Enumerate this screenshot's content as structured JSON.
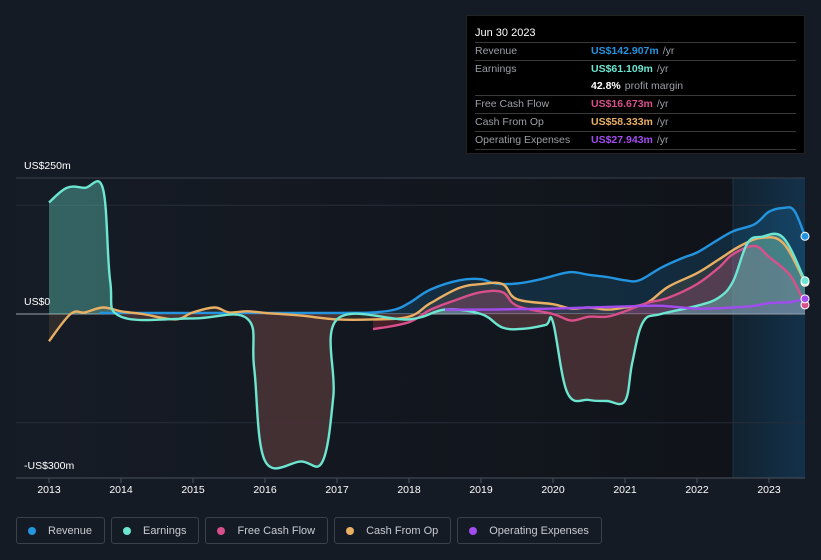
{
  "tooltip": {
    "date": "Jun 30 2023",
    "rows": [
      {
        "label": "Revenue",
        "value": "US$142.907m",
        "unit": "/yr",
        "color": "#2394df"
      },
      {
        "label": "Earnings",
        "value": "US$61.109m",
        "unit": "/yr",
        "color": "#6ce6d1"
      },
      {
        "label": "",
        "value": "42.8%",
        "unit": "profit margin",
        "color": "#ffffff"
      },
      {
        "label": "Free Cash Flow",
        "value": "US$16.673m",
        "unit": "/yr",
        "color": "#d94f8c"
      },
      {
        "label": "Cash From Op",
        "value": "US$58.333m",
        "unit": "/yr",
        "color": "#e9b064"
      },
      {
        "label": "Operating Expenses",
        "value": "US$27.943m",
        "unit": "/yr",
        "color": "#a24cf0"
      }
    ]
  },
  "legend": [
    {
      "label": "Revenue",
      "color": "#2394df"
    },
    {
      "label": "Earnings",
      "color": "#6ce6d1"
    },
    {
      "label": "Free Cash Flow",
      "color": "#d94f8c"
    },
    {
      "label": "Cash From Op",
      "color": "#e9b064"
    },
    {
      "label": "Operating Expenses",
      "color": "#a24cf0"
    }
  ],
  "chart_data": {
    "type": "line",
    "title": "",
    "xlabel": "",
    "ylabel": "",
    "y_tick_labels": [
      "US$250m",
      "US$0",
      "-US$300m"
    ],
    "x_tick_labels": [
      "2013",
      "2014",
      "2015",
      "2016",
      "2017",
      "2018",
      "2019",
      "2020",
      "2021",
      "2022",
      "2023"
    ],
    "xlim": [
      2012.55,
      2023.5
    ],
    "ylim": [
      -340,
      250
    ],
    "grid": true,
    "legend_position": "bottom",
    "highlight_region": [
      2022.5,
      2023.5
    ],
    "series": [
      {
        "name": "Revenue",
        "color": "#2394df",
        "x": [
          2013.7,
          2014.0,
          2015.0,
          2016.0,
          2017.0,
          2017.5,
          2017.8,
          2018.0,
          2018.3,
          2018.7,
          2019.0,
          2019.2,
          2019.5,
          2019.8,
          2020.0,
          2020.25,
          2020.5,
          2020.75,
          2021.0,
          2021.2,
          2021.5,
          2021.8,
          2022.0,
          2022.25,
          2022.5,
          2022.8,
          2023.0,
          2023.2,
          2023.35,
          2023.5
        ],
        "y": [
          2,
          2,
          2,
          2,
          2,
          3,
          8,
          20,
          45,
          62,
          64,
          56,
          56,
          63,
          70,
          77,
          72,
          68,
          62,
          62,
          85,
          103,
          113,
          133,
          152,
          165,
          188,
          195,
          190,
          142.9
        ]
      },
      {
        "name": "Earnings",
        "color": "#6ce6d1",
        "x": [
          2013.0,
          2013.25,
          2013.5,
          2013.75,
          2013.85,
          2014.0,
          2015.0,
          2015.75,
          2015.85,
          2016.0,
          2016.5,
          2016.8,
          2016.95,
          2017.0,
          2018.0,
          2018.5,
          2019.0,
          2019.3,
          2019.6,
          2019.9,
          2020.0,
          2020.2,
          2020.5,
          2020.75,
          2021.0,
          2021.1,
          2021.25,
          2021.5,
          2022.0,
          2022.3,
          2022.5,
          2022.7,
          2022.9,
          2023.2,
          2023.5
        ],
        "y": [
          205,
          232,
          232,
          230,
          60,
          -5,
          -8,
          -8,
          -100,
          -270,
          -271,
          -271,
          -150,
          -10,
          -10,
          8,
          0,
          -25,
          -27,
          -20,
          -15,
          -145,
          -158,
          -160,
          -160,
          -90,
          -15,
          0,
          15,
          30,
          60,
          130,
          142,
          140,
          61.1
        ]
      },
      {
        "name": "Free Cash Flow",
        "color": "#d94f8c",
        "x": [
          2017.5,
          2018.0,
          2018.3,
          2018.7,
          2019.0,
          2019.3,
          2019.5,
          2020.0,
          2020.25,
          2020.5,
          2020.75,
          2021.0,
          2021.3,
          2021.6,
          2022.0,
          2022.3,
          2022.5,
          2022.8,
          2023.0,
          2023.3,
          2023.5
        ],
        "y": [
          -28,
          -15,
          8,
          28,
          40,
          40,
          15,
          0,
          -12,
          -5,
          -5,
          5,
          20,
          30,
          55,
          85,
          110,
          125,
          105,
          70,
          16.7
        ]
      },
      {
        "name": "Cash From Op",
        "color": "#e9b064",
        "x": [
          2013.0,
          2013.3,
          2013.5,
          2013.75,
          2014.0,
          2014.3,
          2014.75,
          2015.0,
          2015.3,
          2015.5,
          2015.75,
          2016.0,
          2016.5,
          2017.0,
          2017.5,
          2018.0,
          2018.3,
          2018.7,
          2019.0,
          2019.3,
          2019.5,
          2020.0,
          2020.25,
          2020.5,
          2020.75,
          2021.0,
          2021.3,
          2021.6,
          2022.0,
          2022.3,
          2022.6,
          2022.9,
          2023.2,
          2023.5
        ],
        "y": [
          -50,
          0,
          3,
          12,
          5,
          0,
          -10,
          3,
          12,
          3,
          5,
          2,
          -3,
          -10,
          -10,
          -5,
          20,
          48,
          55,
          55,
          27,
          18,
          10,
          12,
          8,
          12,
          20,
          50,
          75,
          100,
          125,
          140,
          130,
          58.3
        ]
      },
      {
        "name": "Operating Expenses",
        "color": "#a24cf0",
        "x": [
          2018.5,
          2019.0,
          2019.5,
          2020.0,
          2020.5,
          2021.0,
          2021.5,
          2022.0,
          2022.5,
          2022.8,
          2023.0,
          2023.3,
          2023.5
        ],
        "y": [
          8,
          8,
          9,
          10,
          12,
          14,
          15,
          10,
          12,
          15,
          20,
          22,
          27.9
        ]
      }
    ]
  }
}
